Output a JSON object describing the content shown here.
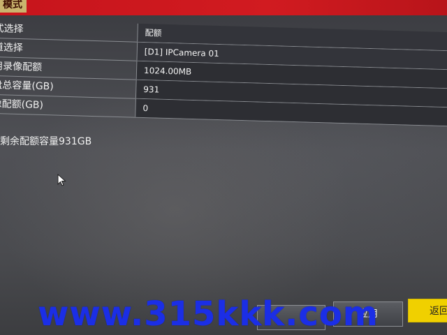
{
  "header": {
    "tab_label": "模式"
  },
  "settings": {
    "rows": [
      {
        "label": "式选择",
        "value": "配额"
      },
      {
        "label": "道选择",
        "value": "[D1] IPCamera 01"
      },
      {
        "label": "用录像配额",
        "value": "1024.00MB"
      },
      {
        "label": "盘总容量(GB)",
        "value": "931"
      },
      {
        "label": "像配额(GB)",
        "value": "0"
      }
    ]
  },
  "info": {
    "remaining_text": "剩余配额容量931GB"
  },
  "buttons": {
    "left_label": "",
    "apply_label": "应用",
    "back_label": "返回"
  },
  "watermark": {
    "text": "www.315kkk.com"
  },
  "colors": {
    "title_bar": "#c7141c",
    "tab_bg": "#c9b46e",
    "back_button": "#f0d000",
    "watermark": "#1b2ee6"
  }
}
